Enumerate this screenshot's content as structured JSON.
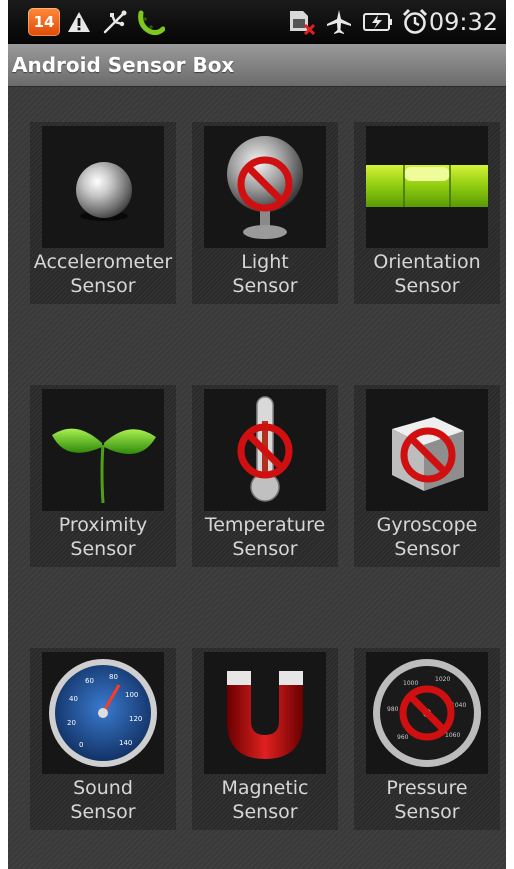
{
  "status_bar": {
    "notification_count": "14",
    "time": "09:32",
    "icons": [
      "notification-badge",
      "warning-icon",
      "usb-debug-icon",
      "sprout-icon",
      "sim-card-error-icon",
      "airplane-mode-icon",
      "battery-charging-icon",
      "alarm-clock-icon"
    ]
  },
  "app": {
    "title": "Android Sensor Box"
  },
  "sensors": [
    {
      "line1": "Accelerometer",
      "line2": "Sensor",
      "available": true
    },
    {
      "line1": "Light",
      "line2": "Sensor",
      "available": false
    },
    {
      "line1": "Orientation",
      "line2": "Sensor",
      "available": true
    },
    {
      "line1": "Proximity",
      "line2": "Sensor",
      "available": true
    },
    {
      "line1": "Temperature",
      "line2": "Sensor",
      "available": false
    },
    {
      "line1": "Gyroscope",
      "line2": "Sensor",
      "available": false
    },
    {
      "line1": "Sound",
      "line2": "Sensor",
      "available": true
    },
    {
      "line1": "Magnetic",
      "line2": "Sensor",
      "available": true
    },
    {
      "line1": "Pressure",
      "line2": "Sensor",
      "available": false
    }
  ],
  "gauge_ticks": {
    "sound": [
      "0",
      "20",
      "40",
      "60",
      "80",
      "100",
      "120",
      "140"
    ],
    "pressure": [
      "960",
      "980",
      "1000",
      "1020",
      "1040",
      "1060"
    ]
  },
  "colors": {
    "unavailable_sign": "#d01010",
    "notification_badge": "#f06a1c",
    "leaf_green": "#5fd02a"
  }
}
